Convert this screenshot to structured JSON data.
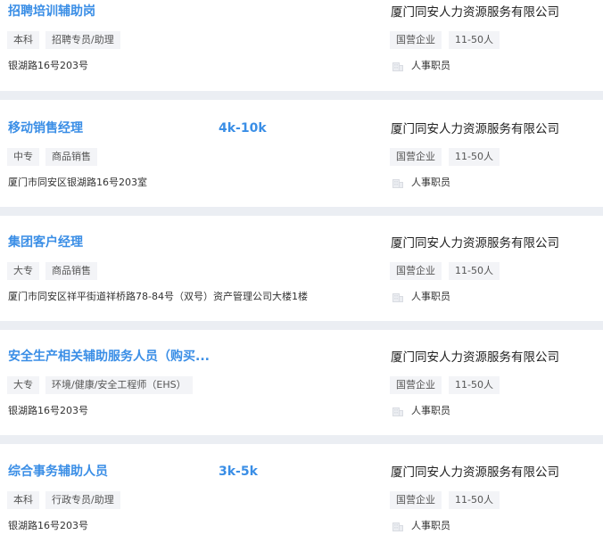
{
  "jobs": [
    {
      "title": "招聘培训辅助岗",
      "salary": "",
      "education": "本科",
      "category": "招聘专员/助理",
      "address": "银湖路16号203号",
      "company": "厦门同安人力资源服务有限公司",
      "company_type": "国营企业",
      "company_size": "11-50人",
      "industry": "人事职员"
    },
    {
      "title": "移动销售经理",
      "salary": "4k-10k",
      "education": "中专",
      "category": "商品销售",
      "address": "厦门市同安区银湖路16号203室",
      "company": "厦门同安人力资源服务有限公司",
      "company_type": "国营企业",
      "company_size": "11-50人",
      "industry": "人事职员"
    },
    {
      "title": "集团客户经理",
      "salary": "",
      "education": "大专",
      "category": "商品销售",
      "address": "厦门市同安区祥平街道祥桥路78-84号（双号）资产管理公司大楼1楼",
      "company": "厦门同安人力资源服务有限公司",
      "company_type": "国营企业",
      "company_size": "11-50人",
      "industry": "人事职员"
    },
    {
      "title": "安全生产相关辅助服务人员（购买...",
      "salary": "",
      "education": "大专",
      "category": "环境/健康/安全工程师（EHS）",
      "address": "银湖路16号203号",
      "company": "厦门同安人力资源服务有限公司",
      "company_type": "国营企业",
      "company_size": "11-50人",
      "industry": "人事职员"
    },
    {
      "title": "综合事务辅助人员",
      "salary": "3k-5k",
      "education": "本科",
      "category": "行政专员/助理",
      "address": "银湖路16号203号",
      "company": "厦门同安人力资源服务有限公司",
      "company_type": "国营企业",
      "company_size": "11-50人",
      "industry": "人事职员"
    }
  ],
  "colors": {
    "accent": "#3a8ee6",
    "separator": "#ebeef3",
    "tag_background": "#f3f4f7"
  },
  "icons": {
    "industry": "building-icon"
  }
}
